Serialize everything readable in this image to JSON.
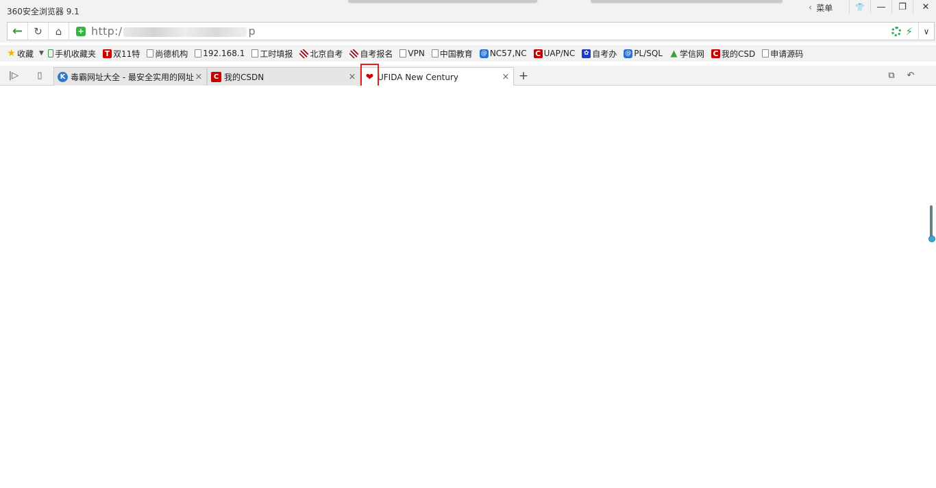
{
  "window": {
    "title": "360安全浏览器 9.1",
    "menu_label": "菜单",
    "menu_chevron": "‹",
    "buttons": {
      "skin": "👕",
      "minimize": "—",
      "restore": "❐",
      "close": "✕"
    }
  },
  "addressbar": {
    "url_prefix": "http:/",
    "url_suffix": "p",
    "back": "←",
    "reload": "↻",
    "home": "⌂",
    "shield": "+",
    "bolt": "⚡",
    "dropdown": "∨"
  },
  "bookmarks": {
    "favorites_label": "收藏",
    "items": [
      {
        "label": "手机收藏夹",
        "icon": "phone-icon"
      },
      {
        "label": "双11特",
        "icon": "tmall-icon",
        "glyph": "T"
      },
      {
        "label": "尚德机构",
        "icon": "page-icon"
      },
      {
        "label": "192.168.1",
        "icon": "page-icon"
      },
      {
        "label": "工时填报",
        "icon": "page-icon"
      },
      {
        "label": "北京自考",
        "icon": "stripe-logo-icon"
      },
      {
        "label": "自考报名",
        "icon": "stripe-logo-icon"
      },
      {
        "label": "VPN",
        "icon": "page-icon"
      },
      {
        "label": "中国教育",
        "icon": "page-icon"
      },
      {
        "label": "NC57,NC",
        "icon": "globe-icon",
        "glyph": "@"
      },
      {
        "label": "UAP/NC",
        "icon": "csdn-icon",
        "glyph": "C"
      },
      {
        "label": "自考办",
        "icon": "paw-icon",
        "glyph": "✿"
      },
      {
        "label": "PL/SQL",
        "icon": "globe-icon",
        "glyph": "@"
      },
      {
        "label": "学信网",
        "icon": "xuexin-icon",
        "glyph": "▲"
      },
      {
        "label": "我的CSD",
        "icon": "csdn-icon",
        "glyph": "C"
      },
      {
        "label": "申请源码",
        "icon": "page-icon"
      }
    ]
  },
  "tabs": [
    {
      "label": "毒霸网址大全 - 最安全实用的网址",
      "icon": "k-icon",
      "glyph": "K",
      "active": false
    },
    {
      "label": "我的CSDN",
      "icon": "csdn-icon",
      "glyph": "C",
      "active": false
    },
    {
      "label": "UFIDA New Century",
      "icon": "heart-icon",
      "glyph": "❤",
      "active": true
    }
  ],
  "tab_close": "×",
  "new_tab": "+",
  "sidebar_toggle": "|▷",
  "mobile_icon": "▯",
  "restore_tabs": "⧉",
  "undo": "↶"
}
